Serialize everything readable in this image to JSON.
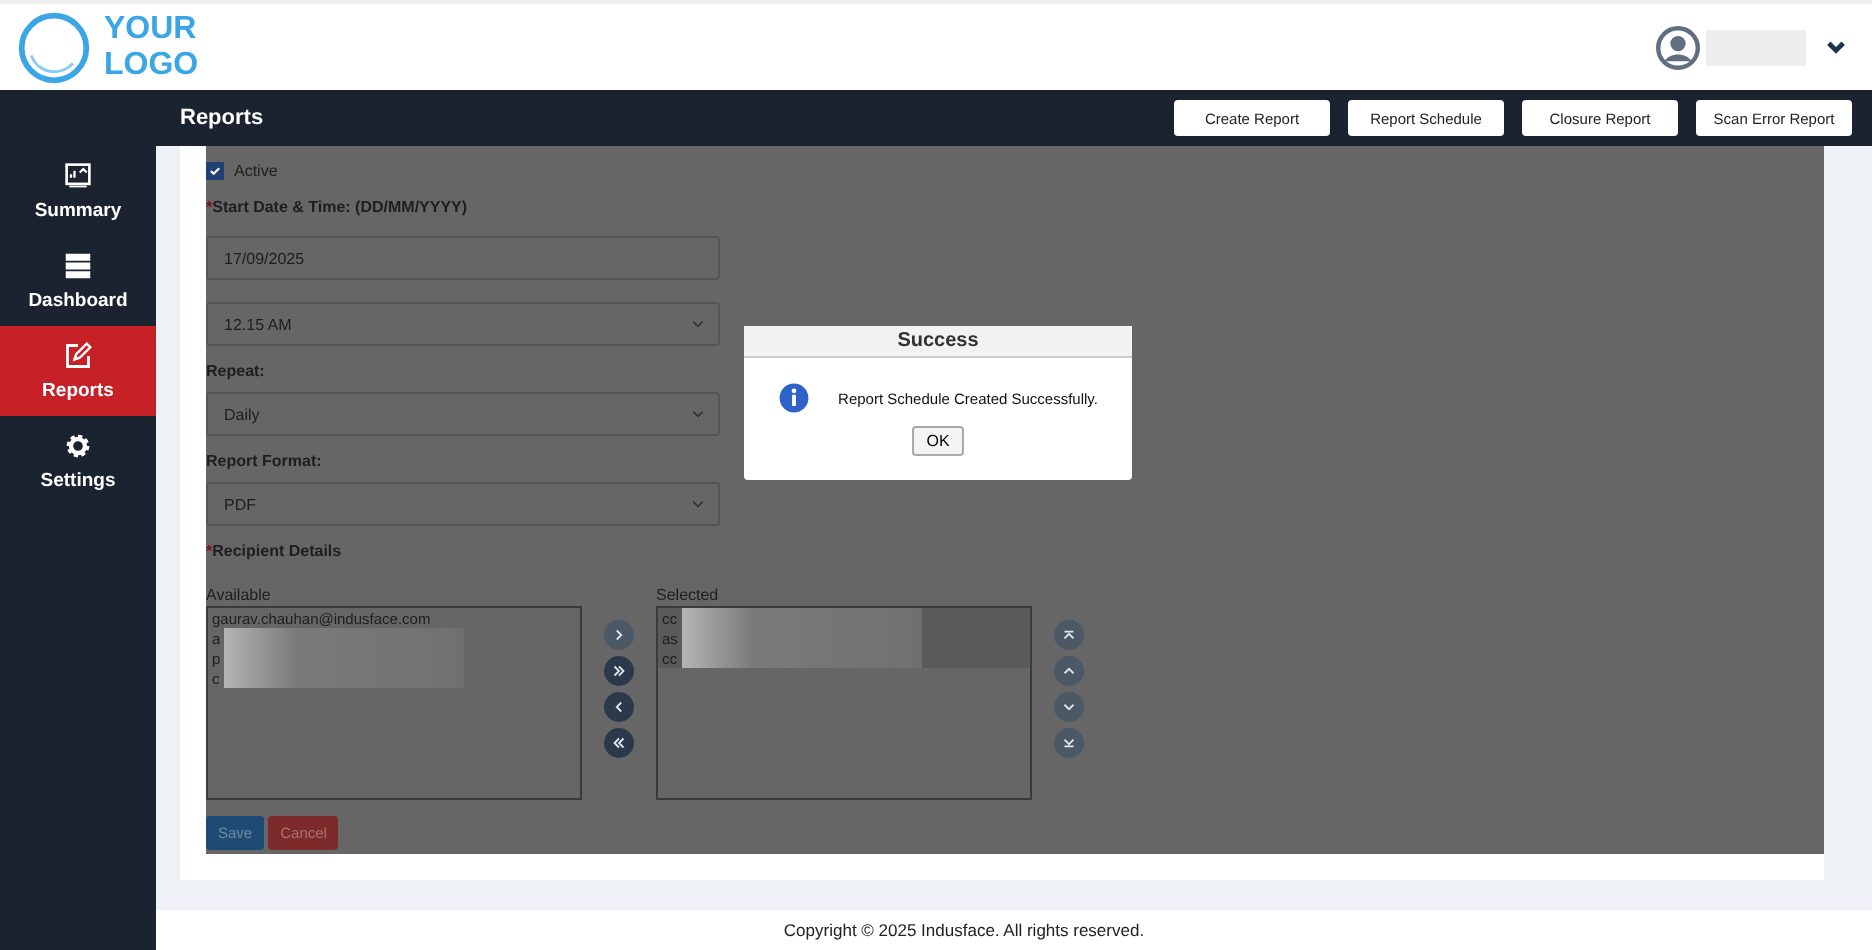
{
  "logo": {
    "line1": "YOUR",
    "line2": "LOGO"
  },
  "sidebar": {
    "items": [
      {
        "label": "Summary",
        "kind": "chart",
        "selected": false
      },
      {
        "label": "Dashboard",
        "kind": "server",
        "selected": false
      },
      {
        "label": "Reports",
        "kind": "edit",
        "selected": true
      },
      {
        "label": "Settings",
        "kind": "gear",
        "selected": false
      }
    ]
  },
  "page_title": "Reports",
  "header_buttons": [
    "Create Report",
    "Report Schedule",
    "Closure Report",
    "Scan Error Report"
  ],
  "form": {
    "fields": [
      {
        "kind": "checkbox",
        "label": "Active",
        "checked": true
      },
      {
        "kind": "label",
        "label": "Start Date & Time: (DD/MM/YYYY)",
        "mark": "*"
      },
      {
        "kind": "input",
        "value": "17/09/2025"
      },
      {
        "kind": "select",
        "value": "12.15 AM"
      },
      {
        "kind": "label",
        "label": "Repeat:"
      },
      {
        "kind": "select",
        "value": "Daily"
      },
      {
        "kind": "label",
        "label": "Report Format:"
      },
      {
        "kind": "select",
        "value": "PDF"
      },
      {
        "kind": "label",
        "label": "Recipient Details",
        "mark": "*"
      }
    ],
    "available": {
      "label": "Available",
      "items": [
        {
          "text": "gaurav.chauhan@indusface.com",
          "selected": false,
          "redacted": false
        },
        {
          "text": "a",
          "selected": false,
          "redacted": true
        },
        {
          "text": "p",
          "selected": false,
          "redacted": true
        },
        {
          "text": "c",
          "selected": false,
          "redacted": true
        }
      ]
    },
    "transfer_buttons": [
      {
        "kind": "right",
        "disabled": true
      },
      {
        "kind": "all-right",
        "disabled": false
      },
      {
        "kind": "left",
        "disabled": false
      },
      {
        "kind": "all-left",
        "disabled": false
      }
    ],
    "selected": {
      "label": "Selected",
      "items": [
        {
          "text": "cc",
          "selected": true,
          "redacted": true
        },
        {
          "text": "as",
          "selected": true,
          "redacted": true
        },
        {
          "text": "cc",
          "selected": true,
          "redacted": true
        }
      ]
    },
    "order_buttons": [
      {
        "kind": "top",
        "disabled": true
      },
      {
        "kind": "up",
        "disabled": true
      },
      {
        "kind": "down",
        "disabled": true
      },
      {
        "kind": "bottom",
        "disabled": true
      }
    ],
    "actions": [
      {
        "label": "Save",
        "kind": "primary"
      },
      {
        "label": "Cancel",
        "kind": "danger"
      }
    ]
  },
  "dialog": {
    "title": "Success",
    "message": "Report Schedule Created Successfully.",
    "button": "OK"
  },
  "footer": "Copyright © 2025 Indusface. All rights reserved."
}
